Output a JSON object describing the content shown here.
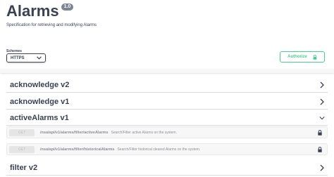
{
  "info": {
    "title": "Alarms",
    "version": "1.0",
    "description": "Specification for retrieving and modifying Alarms"
  },
  "schemes": {
    "label": "Schemes",
    "selected": "HTTPS"
  },
  "authorize": {
    "label": "Authorize",
    "color": "#49cc90"
  },
  "sections": [
    {
      "title": "acknowledge v2",
      "icon": "chevron-right-icon",
      "expanded": false
    },
    {
      "title": "acknowledge v1",
      "icon": "chevron-right-icon",
      "expanded": false
    },
    {
      "title": "activeAlarms v1",
      "icon": "chevron-down-icon",
      "expanded": true
    },
    {
      "title": "filter v2",
      "icon": "chevron-right-icon",
      "expanded": false
    }
  ],
  "operations": [
    {
      "method": "GET",
      "path": "/nsa/api/v1/alarms/filter/activeAlarms",
      "summary": "Search/Filter active Alarms on the system."
    },
    {
      "method": "GET",
      "path": "/nsa/api/v1/alarms/filter/historicalAlarms",
      "summary": "Search/Filter historical cleared Alarms on the system."
    }
  ]
}
